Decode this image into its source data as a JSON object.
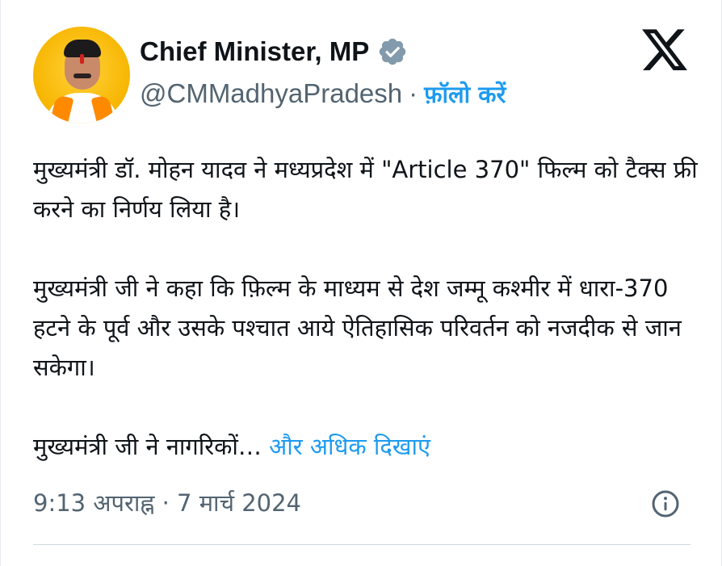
{
  "author": {
    "display_name": "Chief Minister, MP",
    "handle": "@CMMadhyaPradesh",
    "separator": "·",
    "follow_label": "फ़ॉलो करें"
  },
  "icons": {
    "avatar": "profile-photo",
    "verified": "verified-badge-icon",
    "platform": "x-logo-icon",
    "info": "info-icon"
  },
  "tweet": {
    "paragraph_1": "मुख्यमंत्री डॉ. मोहन यादव ने मध्यप्रदेश में \"Article 370\" फिल्म को टैक्स फ्री करने का निर्णय लिया है।",
    "paragraph_2": "मुख्यमंत्री जी ने कहा कि फ़िल्म के माध्यम से देश जम्मू कश्मीर में धारा-370 हटने के पूर्व और उसके पश्चात आये ऐतिहासिक परिवर्तन को नजदीक से जान सकेगा।",
    "paragraph_3": "मुख्यमंत्री जी ने नागरिकों…",
    "show_more_label": "और अधिक दिखाएं"
  },
  "meta": {
    "time": "9:13 अपराह्न",
    "separator": "·",
    "date": "7 मार्च 2024"
  },
  "colors": {
    "text": "#0f1419",
    "secondary": "#536471",
    "link": "#1d9bf0",
    "avatar_bg": "#f7b500",
    "verified_badge": "#829aab"
  }
}
